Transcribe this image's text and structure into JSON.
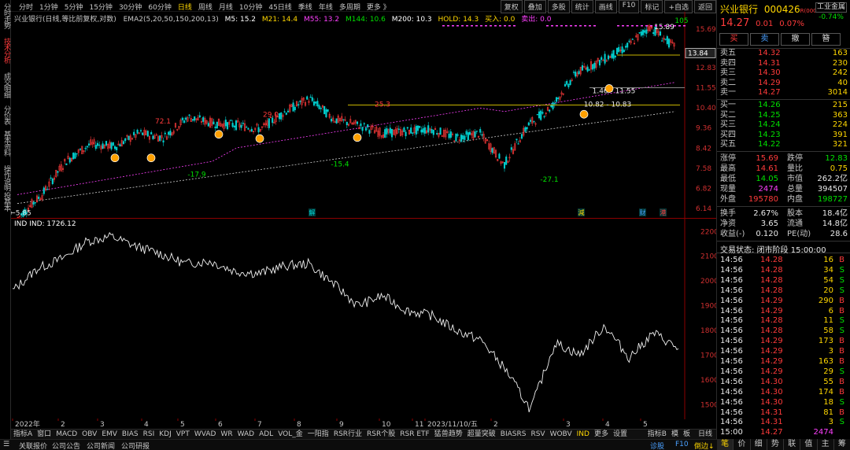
{
  "left_tabs": [
    "分时走势",
    "技术分析",
    "成交明细",
    "分价表",
    "基本资料",
    "操作说明",
    "投基本"
  ],
  "toolbar": {
    "periods": [
      "分时",
      "1分钟",
      "5分钟",
      "15分钟",
      "30分钟",
      "60分钟",
      "日线",
      "周线",
      "月线",
      "10分钟",
      "45日线",
      "季线",
      "年线",
      "多周期",
      "更多 》"
    ],
    "active_period": "日线",
    "tools": [
      "复权",
      "叠加",
      "多股",
      "统计",
      "画线",
      "F10",
      "标记",
      "+自选",
      "返回"
    ]
  },
  "main_header": {
    "title": "兴业银行(日线,等比前复权,对数)",
    "ema": "EMA2(5,20,50,150,200,13)",
    "m5": "M5: 15.2",
    "m21": "M21: 14.4",
    "m55": "M55: 13.2",
    "m144": "M144: 10.6",
    "m200": "M200: 10.3",
    "hold": "HOLD: 14.3",
    "buy": "买入: 0.0",
    "sell": "卖出: 0.0"
  },
  "ind_header": "IND  IND: 1726.12",
  "price_axis": [
    "15.69",
    "13.84",
    "12.83",
    "11.55",
    "10.40",
    "9.36",
    "8.42",
    "7.58",
    "6.82",
    "6.14"
  ],
  "ind_axis": [
    "2200",
    "2100",
    "2000",
    "1900",
    "1800",
    "1700",
    "1600",
    "1500"
  ],
  "time_axis": [
    "2022年",
    "2",
    "3",
    "4",
    "5",
    "6",
    "7",
    "8",
    "9",
    "10",
    "11",
    "2023/11/10/五",
    "2",
    "3",
    "4",
    "5"
  ],
  "chart_annotations": [
    "15.89",
    "105",
    "72.1",
    "29.0",
    "25.3",
    "-17.9",
    "-15.4",
    "-27.1",
    "1.46 - 11.55",
    "10.82 - 10.83",
    "←5.85"
  ],
  "event_markers": [
    "解",
    "減",
    "财",
    "港"
  ],
  "indicator_tabs": [
    "指标A",
    "窗口",
    "MACD",
    "OBV",
    "EMV",
    "BIAS",
    "RSI",
    "KDJ",
    "VPT",
    "WVAD",
    "WR",
    "WAD",
    "ADL",
    "VOL_金",
    "一阳指",
    "RSR行业",
    "RSR个股",
    "RSR ETF",
    "猛兽趋势",
    "超量突破",
    "BIASRS",
    "RSV",
    "WOBV",
    "IND",
    "更多",
    "设置"
  ],
  "active_indicator": "IND",
  "indicator_tabs_right": [
    "指标B",
    "模",
    "板"
  ],
  "period_right": "日线",
  "status_bar": {
    "items": [
      "关联报价",
      "公司公告",
      "公司新闻",
      "公司研报"
    ],
    "right": [
      "诊股",
      "F10",
      "倒边↓"
    ]
  },
  "quote": {
    "name": "兴业银行",
    "code": "000426",
    "suffix": "R(000",
    "sector": "工业金属",
    "sector_change": "-0.74%",
    "price": "14.27",
    "change": "0.01",
    "change_pct": "0.07%",
    "buttons": [
      "买",
      "卖",
      "撤",
      "簪"
    ],
    "asks": [
      {
        "label": "卖五",
        "price": "14.32",
        "vol": "163"
      },
      {
        "label": "卖四",
        "price": "14.31",
        "vol": "230"
      },
      {
        "label": "卖三",
        "price": "14.30",
        "vol": "242"
      },
      {
        "label": "卖二",
        "price": "14.29",
        "vol": "40"
      },
      {
        "label": "卖一",
        "price": "14.27",
        "vol": "3014"
      }
    ],
    "bids": [
      {
        "label": "买一",
        "price": "14.26",
        "vol": "215"
      },
      {
        "label": "买二",
        "price": "14.25",
        "vol": "363"
      },
      {
        "label": "买三",
        "price": "14.24",
        "vol": "224"
      },
      {
        "label": "买四",
        "price": "14.23",
        "vol": "391"
      },
      {
        "label": "买五",
        "price": "14.22",
        "vol": "321"
      }
    ],
    "stats": [
      {
        "l1": "涨停",
        "v1": "15.69",
        "c1": "red",
        "l2": "跌停",
        "v2": "12.83",
        "c2": "green"
      },
      {
        "l1": "最高",
        "v1": "14.61",
        "c1": "red",
        "l2": "量比",
        "v2": "0.75",
        "c2": "yellow"
      },
      {
        "l1": "最低",
        "v1": "14.05",
        "c1": "green",
        "l2": "市值",
        "v2": "262.2亿",
        "c2": "white"
      },
      {
        "l1": "现量",
        "v1": "2474",
        "c1": "purple",
        "l2": "总量",
        "v2": "394507",
        "c2": "white"
      },
      {
        "l1": "外盘",
        "v1": "195780",
        "c1": "red",
        "l2": "内盘",
        "v2": "198727",
        "c2": "green"
      }
    ],
    "stats2": [
      {
        "l1": "换手",
        "v1": "2.67%",
        "c1": "white",
        "l2": "股本",
        "v2": "18.4亿",
        "c2": "white"
      },
      {
        "l1": "净资",
        "v1": "3.65",
        "c1": "white",
        "l2": "流通",
        "v2": "14.8亿",
        "c2": "white"
      },
      {
        "l1": "收益(-)",
        "v1": "0.120",
        "c1": "white",
        "l2": "PE(动)",
        "v2": "28.6",
        "c2": "white"
      }
    ],
    "trade_state": "交易状态: 闭市阶段 15:00:00",
    "ticks": [
      {
        "t": "14:56",
        "p": "14.28",
        "v": "16",
        "s": "B"
      },
      {
        "t": "14:56",
        "p": "14.28",
        "v": "34",
        "s": "S"
      },
      {
        "t": "14:56",
        "p": "14.28",
        "v": "54",
        "s": "S"
      },
      {
        "t": "14:56",
        "p": "14.28",
        "v": "20",
        "s": "S"
      },
      {
        "t": "14:56",
        "p": "14.29",
        "v": "290",
        "s": "B"
      },
      {
        "t": "14:56",
        "p": "14.29",
        "v": "6",
        "s": "B"
      },
      {
        "t": "14:56",
        "p": "14.28",
        "v": "11",
        "s": "S"
      },
      {
        "t": "14:56",
        "p": "14.28",
        "v": "58",
        "s": "S"
      },
      {
        "t": "14:56",
        "p": "14.29",
        "v": "173",
        "s": "B"
      },
      {
        "t": "14:56",
        "p": "14.29",
        "v": "3",
        "s": "B"
      },
      {
        "t": "14:56",
        "p": "14.29",
        "v": "163",
        "s": "B"
      },
      {
        "t": "14:56",
        "p": "14.29",
        "v": "29",
        "s": "S"
      },
      {
        "t": "14:56",
        "p": "14.30",
        "v": "55",
        "s": "B"
      },
      {
        "t": "14:56",
        "p": "14.30",
        "v": "174",
        "s": "B"
      },
      {
        "t": "14:56",
        "p": "14.30",
        "v": "18",
        "s": "S"
      },
      {
        "t": "14:56",
        "p": "14.31",
        "v": "81",
        "s": "B"
      },
      {
        "t": "14:56",
        "p": "14.31",
        "v": "3",
        "s": "S"
      },
      {
        "t": "15:00",
        "p": "14.27",
        "v": "2474",
        "s": ""
      }
    ],
    "bottom_tabs": [
      "笔",
      "价",
      "细",
      "势",
      "联",
      "值",
      "主",
      "筹"
    ]
  },
  "chart_data": [
    {
      "type": "line",
      "title": "兴业银行(日线,等比前复权,对数)",
      "series": [
        {
          "name": "price",
          "values": [
            5.85,
            6.6,
            7.9,
            8.6,
            8.5,
            9.1,
            8.9,
            9.9,
            9.6,
            9.5,
            9.3,
            10.2,
            10.9,
            9.8,
            9.5,
            9.1,
            9.2,
            9.3,
            8.9,
            9.1,
            7.7,
            9.5,
            10.5,
            12.5,
            13.3,
            14.2,
            15.89,
            14.27
          ]
        }
      ],
      "ylim": [
        6.14,
        15.69
      ],
      "xlabel": "",
      "ylabel": ""
    },
    {
      "type": "line",
      "title": "IND",
      "series": [
        {
          "name": "IND",
          "values": [
            1960,
            2050,
            2090,
            2160,
            2180,
            2140,
            2110,
            2070,
            2080,
            2040,
            2030,
            2060,
            2070,
            1990,
            1900,
            1940,
            1880,
            1860,
            1800,
            1760,
            1640,
            1480,
            1750,
            1700,
            1820,
            1690,
            1790,
            1726.12
          ]
        }
      ],
      "ylim": [
        1450,
        2220
      ],
      "xlabel": "",
      "ylabel": ""
    }
  ]
}
